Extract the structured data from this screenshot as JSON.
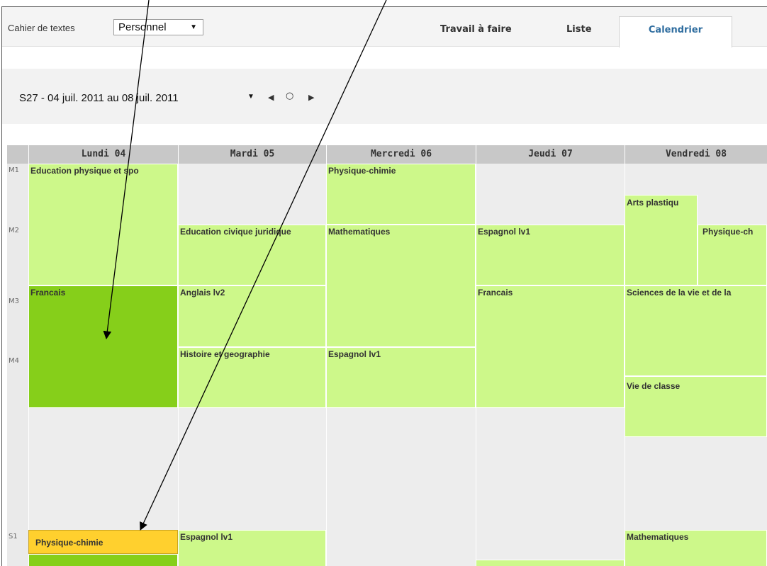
{
  "toolbar": {
    "cahier_label": "Cahier de textes",
    "cahier_value": "Personnel",
    "tabs": [
      {
        "label": "Travail à faire"
      },
      {
        "label": "Liste"
      },
      {
        "label": "Calendrier",
        "active": true
      }
    ]
  },
  "nav": {
    "week": "S27 - 04 juil. 2011 au 08 juil. 2011",
    "prev_icon": "triangle-left-icon",
    "today_icon": "circle-icon",
    "next_icon": "triangle-right-icon"
  },
  "calendar": {
    "days": [
      "Lundi 04",
      "Mardi 05",
      "Mercredi 06",
      "Jeudi 07",
      "Vendredi 08"
    ],
    "slots": [
      "M1",
      "M2",
      "M3",
      "M4",
      "S1"
    ],
    "events": {
      "lun_edu": "Education physique et spo",
      "lun_fr": "Francais",
      "lun_pc": "Physique-chimie",
      "mar_civ": "Education civique juridique",
      "mar_ang": "Anglais lv2",
      "mar_hist": "Histoire et geographie",
      "mar_esp": "Espagnol lv1",
      "mer_pc": "Physique-chimie",
      "mer_math": "Mathematiques",
      "mer_esp": "Espagnol lv1",
      "jeu_esp": "Espagnol lv1",
      "jeu_fr": "Francais",
      "ven_arts": "Arts plastiqu",
      "ven_pc": "Physique-ch",
      "ven_svt": "Sciences de la vie et de la",
      "ven_vie": "Vie de classe",
      "ven_math": "Mathematiques"
    }
  },
  "colors": {
    "event": "#cdf88a",
    "event_selected": "#86cf1a",
    "event_highlight": "#ffd02e",
    "active_tab_text": "#2f6d9f"
  }
}
